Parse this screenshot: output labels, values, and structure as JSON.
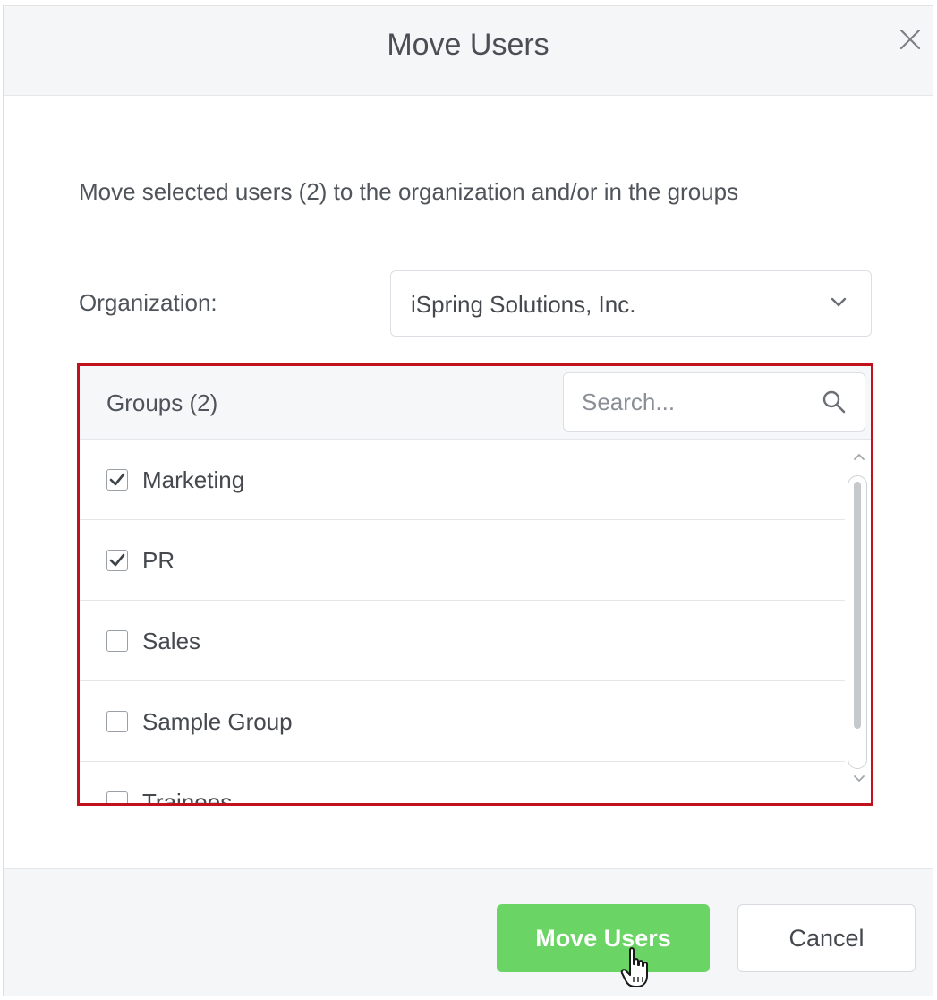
{
  "dialog": {
    "title": "Move Users",
    "close_icon": "close-icon",
    "description": "Move selected users (2) to the organization and/or in the groups"
  },
  "organization": {
    "label": "Organization:",
    "selected": "iSpring Solutions, Inc.",
    "chevron_icon": "chevron-down-icon"
  },
  "groups": {
    "title": "Groups (2)",
    "search_placeholder": "Search...",
    "search_icon": "search-icon",
    "items": [
      {
        "label": "Marketing",
        "checked": true
      },
      {
        "label": "PR",
        "checked": true
      },
      {
        "label": "Sales",
        "checked": false
      },
      {
        "label": "Sample Group",
        "checked": false
      },
      {
        "label": "Trainees",
        "checked": false
      }
    ]
  },
  "footer": {
    "primary_label": "Move Users",
    "secondary_label": "Cancel"
  },
  "colors": {
    "primary": "#6ad464",
    "highlight_border": "#c0111d",
    "header_bg": "#f5f6f7"
  }
}
